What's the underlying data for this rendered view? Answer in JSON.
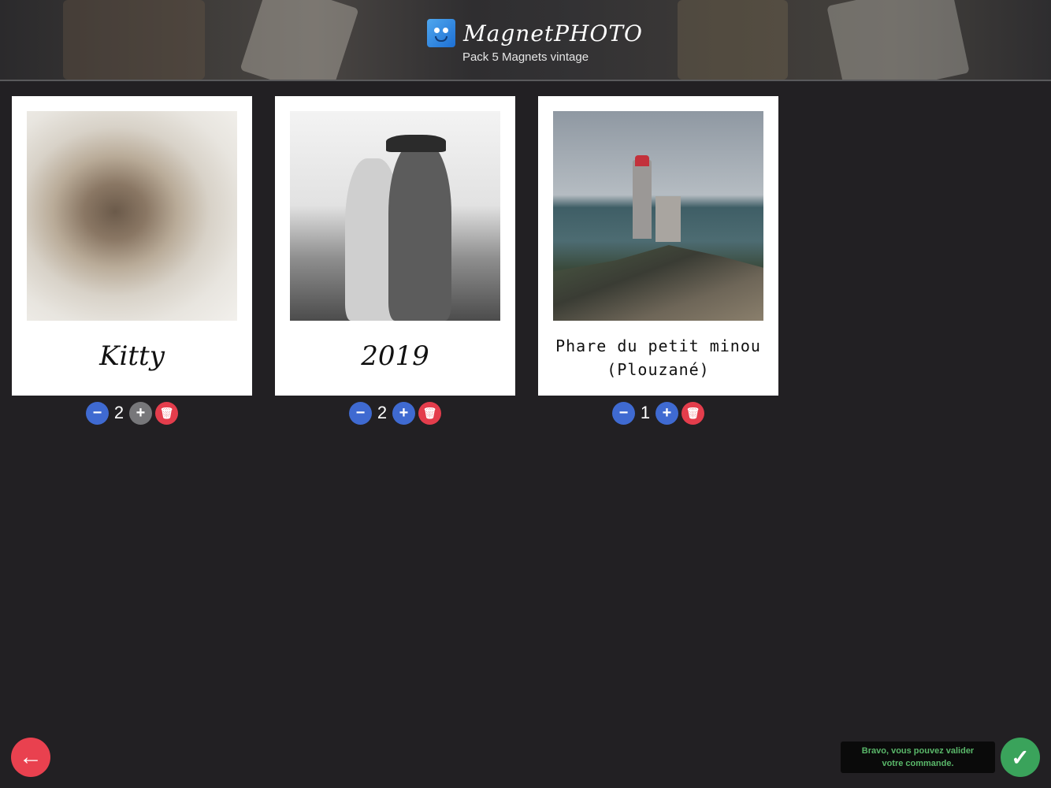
{
  "header": {
    "brand_name": "MagnetPHOTO",
    "subtitle": "Pack 5 Magnets vintage"
  },
  "cards": [
    {
      "caption": "Kitty",
      "quantity": "2",
      "image": "kitten-photo"
    },
    {
      "caption": "2019",
      "quantity": "2",
      "image": "couple-photo"
    },
    {
      "caption_lines": [
        "Phare du petit minou",
        "(Plouzané)"
      ],
      "quantity": "1",
      "image": "lighthouse-photo"
    }
  ],
  "toast": {
    "message_line1": "Bravo, vous pouvez valider",
    "message_line2": "votre commande."
  },
  "icons": {
    "minus": "−",
    "plus": "+",
    "delete": "🗑",
    "back": "←",
    "check": "✓"
  },
  "colors": {
    "background": "#222023",
    "quantity_button": "#3f6ad1",
    "plus_disabled": "#77777a",
    "delete_button": "#e43d4c",
    "back_button": "#e9414f",
    "validate_button": "#3aa35b",
    "toast_text": "#5ab86a"
  }
}
